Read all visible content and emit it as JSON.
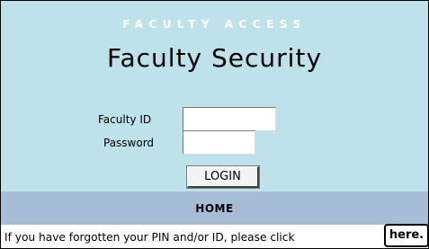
{
  "header": {
    "banner": "FACULTY ACCESS",
    "title": "Faculty Security"
  },
  "form": {
    "id_label": "Faculty ID",
    "id_value": "",
    "password_label": "Password",
    "password_value": "",
    "login_label": "LOGIN"
  },
  "nav": {
    "home_label": "HOME"
  },
  "footer": {
    "message": "If you have forgotten your PIN and/or ID, please click",
    "link_label": "here."
  },
  "colors": {
    "panel_background": "#bde2e9",
    "nav_background": "#a5bdd5",
    "banner_text": "#ffffff"
  }
}
